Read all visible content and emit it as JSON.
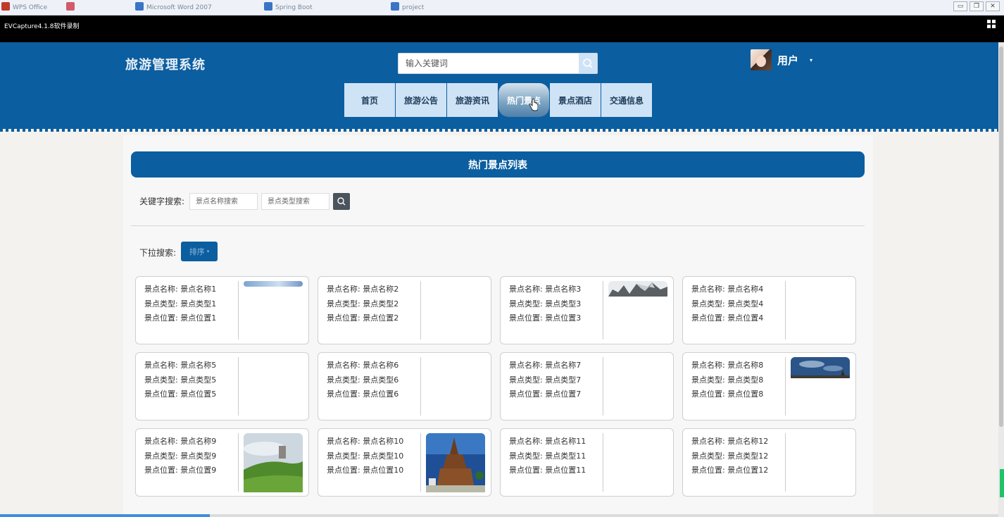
{
  "os": {
    "tabs": [
      {
        "label": "WPS Office",
        "color": "#c0392b"
      },
      {
        "label": "",
        "color": "#d35a6a"
      },
      {
        "label": "Microsoft Word 2007",
        "color": "#3b73c7"
      },
      {
        "label": "Spring Boot",
        "color": "#3b73c7"
      },
      {
        "label": "project",
        "color": "#3b73c7"
      }
    ],
    "controls": [
      "▭",
      "❐",
      "✕"
    ]
  },
  "capture": {
    "title": "EVCapture4.1.8软件录制"
  },
  "header": {
    "site_title": "旅游管理系统",
    "search_placeholder": "输入关键词",
    "user_name": "用户",
    "user_caret": "▾",
    "nav": [
      "首页",
      "旅游公告",
      "旅游资讯",
      "热门景点",
      "景点酒店",
      "交通信息"
    ],
    "active_index": 3
  },
  "main": {
    "section_title": "热门景点列表",
    "keyword_label": "关键字搜索:",
    "name_placeholder": "景点名称搜索",
    "type_placeholder": "景点类型搜索",
    "dropdown_label": "下拉搜索:",
    "sort_label": "排序",
    "sort_caret": "▾",
    "cards": [
      {
        "name": "景点名称: 景点名称1",
        "type": "景点类型: 景点类型1",
        "location": "景点位置: 景点位置1",
        "image": "sky"
      },
      {
        "name": "景点名称: 景点名称2",
        "type": "景点类型: 景点类型2",
        "location": "景点位置: 景点位置2",
        "image": ""
      },
      {
        "name": "景点名称: 景点名称3",
        "type": "景点类型: 景点类型3",
        "location": "景点位置: 景点位置3",
        "image": "mountain"
      },
      {
        "name": "景点名称: 景点名称4",
        "type": "景点类型: 景点类型4",
        "location": "景点位置: 景点位置4",
        "image": ""
      },
      {
        "name": "景点名称: 景点名称5",
        "type": "景点类型: 景点类型5",
        "location": "景点位置: 景点位置5",
        "image": ""
      },
      {
        "name": "景点名称: 景点名称6",
        "type": "景点类型: 景点类型6",
        "location": "景点位置: 景点位置6",
        "image": ""
      },
      {
        "name": "景点名称: 景点名称7",
        "type": "景点类型: 景点类型7",
        "location": "景点位置: 景点位置7",
        "image": ""
      },
      {
        "name": "景点名称: 景点名称8",
        "type": "景点类型: 景点类型8",
        "location": "景点位置: 景点位置8",
        "image": "bluesky"
      },
      {
        "name": "景点名称: 景点名称9",
        "type": "景点类型: 景点类型9",
        "location": "景点位置: 景点位置9",
        "image": "hill"
      },
      {
        "name": "景点名称: 景点名称10",
        "type": "景点类型: 景点类型10",
        "location": "景点位置: 景点位置10",
        "image": "church"
      },
      {
        "name": "景点名称: 景点名称11",
        "type": "景点类型: 景点类型11",
        "location": "景点位置: 景点位置11",
        "image": ""
      },
      {
        "name": "景点名称: 景点名称12",
        "type": "景点类型: 景点类型12",
        "location": "景点位置: 景点位置12",
        "image": ""
      }
    ]
  },
  "colors": {
    "brand": "#0b5e9f",
    "nav_bg": "#cfe3f6",
    "panel": "#f7f7f7"
  },
  "progress": {
    "fraction": 0.21
  }
}
